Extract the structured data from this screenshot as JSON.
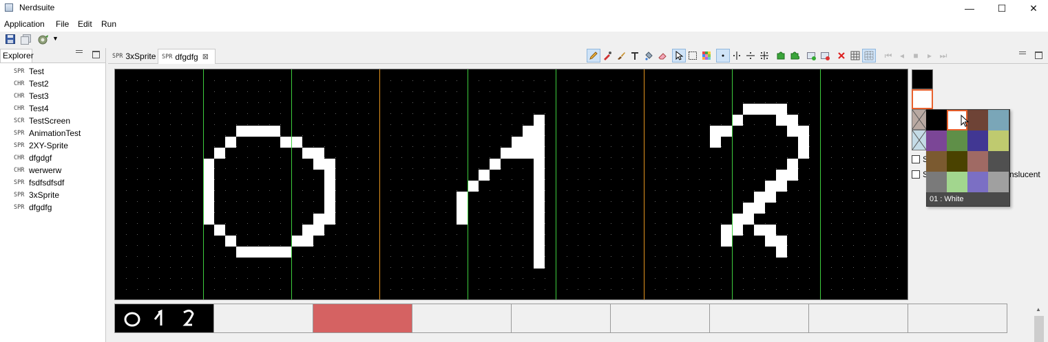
{
  "window": {
    "title": "Nerdsuite",
    "minimize_glyph": "—",
    "maximize_glyph": "☐",
    "close_glyph": "✕"
  },
  "menu": [
    "Application",
    "File",
    "Edit",
    "Run"
  ],
  "explorer": {
    "tab_label": "Explorer",
    "items": [
      {
        "tag": "SPR",
        "label": "Test"
      },
      {
        "tag": "CHR",
        "label": "Test2"
      },
      {
        "tag": "CHR",
        "label": "Test3"
      },
      {
        "tag": "CHR",
        "label": "Test4"
      },
      {
        "tag": "SCR",
        "label": "TestScreen"
      },
      {
        "tag": "SPR",
        "label": "AnimationTest"
      },
      {
        "tag": "SPR",
        "label": "2XY-Sprite"
      },
      {
        "tag": "CHR",
        "label": "dfgdgf"
      },
      {
        "tag": "CHR",
        "label": "werwerw"
      },
      {
        "tag": "SPR",
        "label": "fsdfsdfsdf"
      },
      {
        "tag": "SPR",
        "label": "3xSprite"
      },
      {
        "tag": "SPR",
        "label": "dfgdfg"
      }
    ]
  },
  "editor_tabs": [
    {
      "tag": "SPR",
      "label": "3xSprite",
      "active": false
    },
    {
      "tag": "SPR",
      "label": "dfgdfg",
      "active": true,
      "close_glyph": "⊠"
    }
  ],
  "toolbar_icons": [
    "pencil-icon",
    "eyedropper-icon",
    "brush-icon",
    "text-icon",
    "fill-icon",
    "eraser-icon",
    "pointer-icon",
    "marquee-icon",
    "palette-grid-icon",
    "dot-icon",
    "mirror-vertical-icon",
    "mirror-horizontal-icon",
    "mirror-both-icon",
    "puzzle-add-icon",
    "puzzle-icon",
    "add-frame-icon",
    "remove-frame-icon",
    "delete-icon",
    "grid-icon",
    "dotted-grid-icon",
    "first-frame-icon",
    "prev-frame-icon",
    "stop-icon",
    "play-icon",
    "last-frame-icon"
  ],
  "right_panel": {
    "checkbox_1_label": "S",
    "checkbox_2_label": "S",
    "checkbox_2_suffix": "nslucent"
  },
  "palette": {
    "tooltip": "01 : White",
    "selected_index": 1,
    "colors": [
      "#000000",
      "#ffffff",
      "#6e4336",
      "#7aa6b8",
      "#7b4696",
      "#5f8f48",
      "#413793",
      "#bfca6f",
      "#7b5a30",
      "#4a4200",
      "#a06a64",
      "#505050",
      "#7a7a7a",
      "#a2d68e",
      "#7b6fc4",
      "#a0a0a0"
    ]
  },
  "colors": {
    "canvas_bg": "#000000",
    "pixel_on": "#ffffff",
    "char_grid": "#3ecf3e",
    "sprite_grid": "#e6951e",
    "frame_selected": "#d56262",
    "accent_orange": "#e8602c"
  },
  "frames": {
    "count": 9,
    "selected_index": 2
  }
}
